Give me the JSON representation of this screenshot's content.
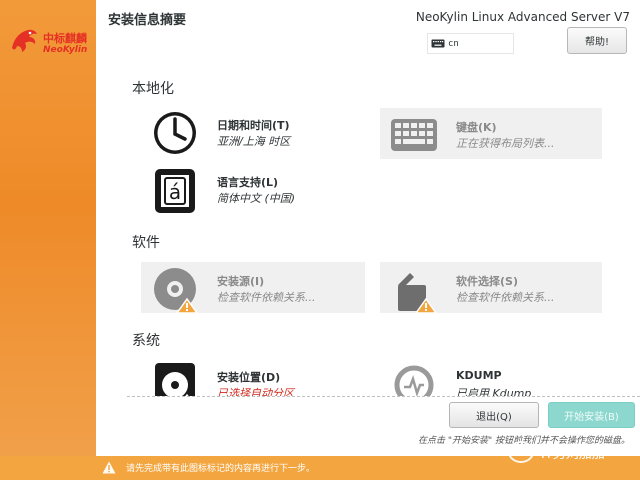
{
  "sidebar": {
    "logo_text_cn": "中标麒麟",
    "logo_text_en": "NeoKylin",
    "background_color": "#ef8e2d"
  },
  "header": {
    "page_title": "安装信息摘要",
    "product_title": "NeoKylin Linux Advanced Server V7",
    "keyboard_layout": "cn",
    "help_label": "帮助!"
  },
  "sections": {
    "localization": {
      "title": "本地化",
      "spokes": [
        {
          "name": "日期和时间(T)",
          "status": "亚洲/上海 时区",
          "icon": "clock-icon",
          "enabled": true
        },
        {
          "name": "键盘(K)",
          "status": "正在获得布局列表...",
          "icon": "keyboard-icon",
          "enabled": false
        },
        {
          "name": "语言支持(L)",
          "status": "简体中文 (中国)",
          "icon": "language-icon",
          "enabled": true
        }
      ]
    },
    "software": {
      "title": "软件",
      "spokes": [
        {
          "name": "安装源(I)",
          "status": "检查软件依赖关系...",
          "icon": "disc-icon",
          "enabled": false,
          "warning": true
        },
        {
          "name": "软件选择(S)",
          "status": "检查软件依赖关系...",
          "icon": "package-icon",
          "enabled": false,
          "warning": true
        }
      ]
    },
    "system": {
      "title": "系统",
      "spokes": [
        {
          "name": "安装位置(D)",
          "status": "已选择自动分区",
          "icon": "harddisk-icon",
          "enabled": true,
          "warning": true
        },
        {
          "name": "KDUMP",
          "status": "已启用 Kdump",
          "icon": "kdump-icon",
          "enabled": true
        }
      ]
    }
  },
  "actions": {
    "quit_label": "退出(Q)",
    "begin_label": "开始安装(B)",
    "footnote": "在点击 \"开始安装\" 按钮前我们并不会操作您的磁盘。"
  },
  "warning_bar": {
    "text": "请先完成带有此图标标记的内容再进行下一步。",
    "color": "#f3a640"
  },
  "watermark": {
    "text": "IT男刘加加"
  },
  "colors": {
    "accent_orange": "#ef8e2d",
    "error_red": "#d22a1e",
    "begin_button": "#8cd8cf"
  }
}
